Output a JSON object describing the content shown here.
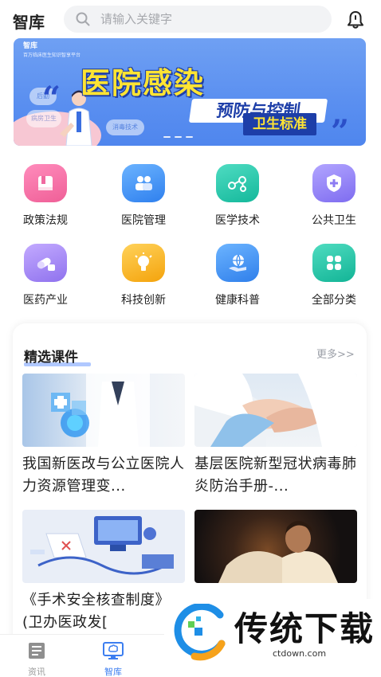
{
  "header": {
    "title": "智库",
    "search_placeholder": "请输入关键字"
  },
  "banner": {
    "logo_text": "智库",
    "logo_sub": "百万临床医生知识智享平台",
    "title": "医院感染",
    "subtitle": "预防与控制",
    "tag": "卫生标准",
    "bubbles": [
      "后勤",
      "病房卫生",
      "消毒技术"
    ],
    "page_count": 3
  },
  "categories": [
    {
      "label": "政策法规",
      "icon": "book-icon",
      "color": "#f06aa0"
    },
    {
      "label": "医院管理",
      "icon": "people-icon",
      "color": "#3c8ef0"
    },
    {
      "label": "医学技术",
      "icon": "molecule-icon",
      "color": "#22c2a8"
    },
    {
      "label": "公共卫生",
      "icon": "shield-plus-icon",
      "color": "#8d7cf2"
    },
    {
      "label": "医药产业",
      "icon": "pill-icon",
      "color": "#9b7ff3"
    },
    {
      "label": "科技创新",
      "icon": "lightbulb-icon",
      "color": "#f8b31c"
    },
    {
      "label": "健康科普",
      "icon": "globe-hand-icon",
      "color": "#3b8cf0"
    },
    {
      "label": "全部分类",
      "icon": "grid-icon",
      "color": "#20c0a6"
    }
  ],
  "featured": {
    "title": "精选课件",
    "more": "更多>>",
    "courses": [
      {
        "title": "我国新医改与公立医院人力资源管理变..."
      },
      {
        "title": "基层医院新型冠状病毒肺炎防治手册-..."
      },
      {
        "title": "《手术安全核查制度》(卫办医政发["
      },
      {
        "title": ""
      }
    ]
  },
  "bottom_nav": [
    {
      "label": "资讯",
      "active": false
    },
    {
      "label": "智库",
      "active": true
    }
  ],
  "colors": {
    "accent": "#3c7ef0",
    "inactive": "#9a9a9a"
  },
  "watermark": {
    "text": "传统下载",
    "url": "ctdown.com"
  }
}
